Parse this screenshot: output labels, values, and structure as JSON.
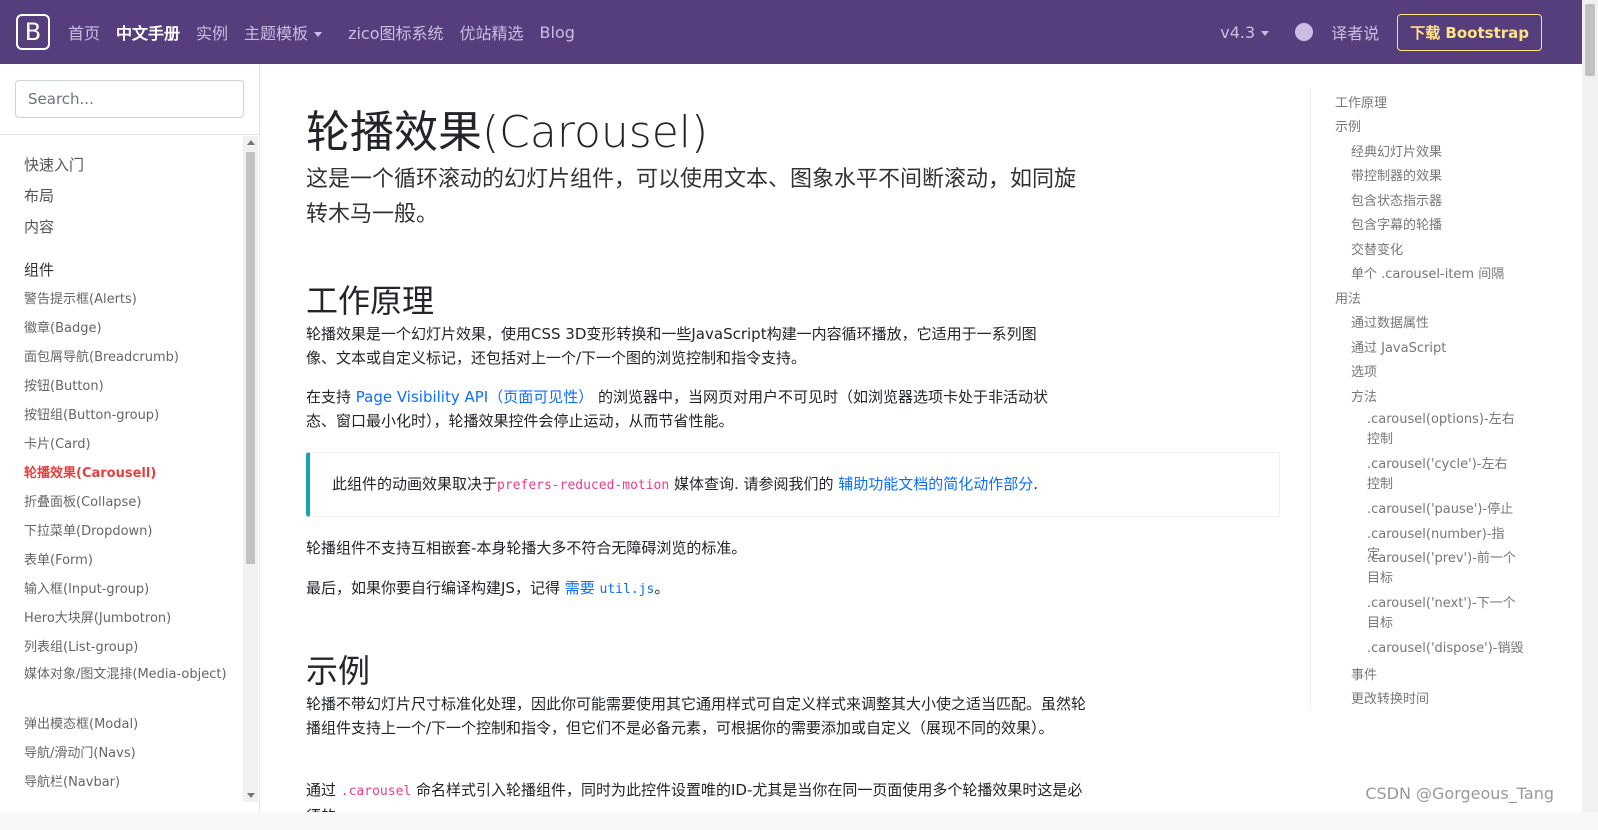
{
  "navbar": {
    "brand": "B",
    "links": [
      {
        "label": "首页",
        "active": false
      },
      {
        "label": "中文手册",
        "active": true
      },
      {
        "label": "实例",
        "active": false
      },
      {
        "label": "主题模板",
        "active": false
      },
      {
        "label": "zico图标系统",
        "active": false
      },
      {
        "label": "优站精选",
        "active": false
      },
      {
        "label": "Blog",
        "active": false
      }
    ],
    "version": "v4.3",
    "translator": "译者说",
    "download": "下载 Bootstrap"
  },
  "sidebar": {
    "search_placeholder": "Search...",
    "groups": [
      "快速入门",
      "布局",
      "内容"
    ],
    "components_header": "组件",
    "items": [
      "警告提示框(Alerts)",
      "徽章(Badge)",
      "面包屑导航(Breadcrumb)",
      "按钮(Button)",
      "按钮组(Button-group)",
      "卡片(Card)",
      "轮播效果(Carousell)",
      "折叠面板(Collapse)",
      "下拉菜单(Dropdown)",
      "表单(Form)",
      "输入框(Input-group)",
      "Hero大块屏(Jumbotron)",
      "列表组(List-group)",
      "媒体对象/图文混排(Media-object)",
      "弹出模态框(Modal)",
      "导航/滑动门(Navs)",
      "导航栏(Navbar)"
    ],
    "active_item": "轮播效果(Carousell)"
  },
  "main": {
    "title": "轮播效果(Carousel)",
    "lead": "这是一个循环滚动的幻灯片组件，可以使用文本、图象水平不间断滚动，如同旋转木马一般。",
    "h_how": "工作原理",
    "p1": "轮播效果是一个幻灯片效果，使用CSS 3D变形转换和一些JavaScript构建一内容循环播放，它适用于一系列图像、文本或自定义标记，还包括对上一个/下一个图的浏览控制和指令支持。",
    "p2_pre": "在支持 ",
    "p2_link": "Page Visibility API（页面可见性）",
    "p2_post": " 的浏览器中，当网页对用户不可见时（如浏览器选项卡处于非活动状态、窗口最小化时），轮播效果控件会停止运动，从而节省性能。",
    "callout_pre": "此组件的动画效果取决于",
    "callout_code": "prefers-reduced-motion",
    "callout_mid": " 媒体查询. 请参阅我们的 ",
    "callout_link": "辅助功能文档的简化动作部分",
    "callout_post": ".",
    "p3": "轮播组件不支持互相嵌套-本身轮播大多不符合无障碍浏览的标准。",
    "p4_pre": "最后，如果你要自行编译构建JS，记得 ",
    "p4_link": "需要",
    "p4_code": "util.js",
    "p4_post": "。",
    "h_example": "示例",
    "p5": "轮播不带幻灯片尺寸标准化处理，因此你可能需要使用其它通用样式可自定义样式来调整其大小使之适当匹配。虽然轮播组件支持上一个/下一个控制和指令，但它们不是必备元素，可根据你的需要添加或自定义（展现不同的效果）。",
    "p6_pre": "通过 ",
    "p6_code": ".carousel",
    "p6_post": " 命名样式引入轮播组件，同时为此控件设置唯的ID-尤其是当你在同一页面使用多个轮播效果时这是必须的。"
  },
  "toc": {
    "l1_how": "工作原理",
    "l1_example": "示例",
    "examples": [
      "经典幻灯片效果",
      "带控制器的效果",
      "包含状态指示器",
      "包含字幕的轮播",
      "交替变化",
      "单个 .carousel-item 间隔"
    ],
    "l1_usage": "用法",
    "usage": [
      "通过数据属性",
      "通过 JavaScript",
      "选项",
      "方法"
    ],
    "methods": [
      ".carousel(options)-左右控制",
      ".carousel('cycle')-左右控制",
      ".carousel('pause')-停止",
      ".carousel(number)-指定",
      ".carousel('prev')-前一个目标",
      ".carousel('next')-下一个目标",
      ".carousel('dispose')-销毁"
    ],
    "events": "事件",
    "transition": "更改转换时间"
  },
  "watermark": "CSDN @Gorgeous_Tang"
}
